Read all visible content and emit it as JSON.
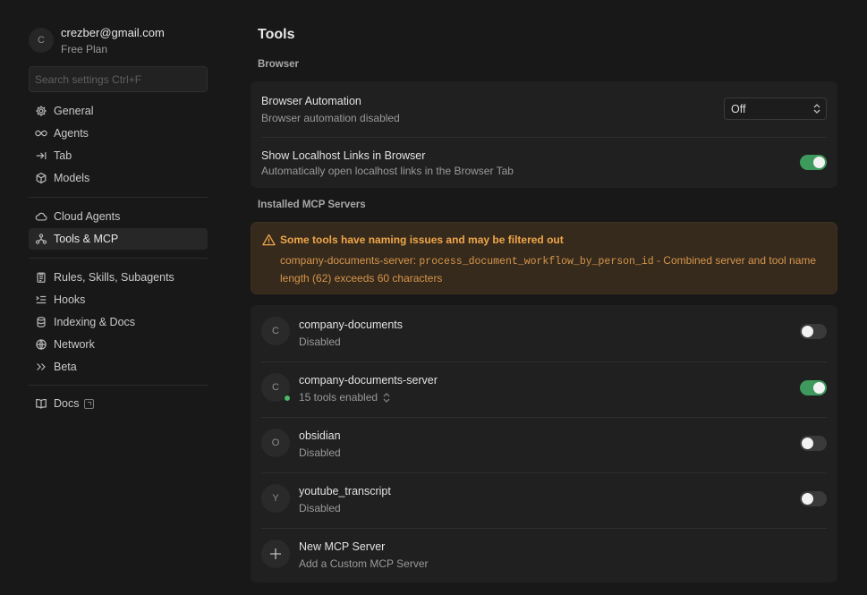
{
  "account": {
    "avatar_letter": "C",
    "email": "crezber@gmail.com",
    "plan": "Free Plan"
  },
  "search": {
    "placeholder": "Search settings Ctrl+F"
  },
  "sidebar": {
    "group1": [
      {
        "label": "General",
        "icon": "gear-icon"
      },
      {
        "label": "Agents",
        "icon": "infinity-icon"
      },
      {
        "label": "Tab",
        "icon": "tab-arrow-icon"
      },
      {
        "label": "Models",
        "icon": "cube-icon"
      }
    ],
    "group2": [
      {
        "label": "Cloud Agents",
        "icon": "cloud-icon"
      },
      {
        "label": "Tools & MCP",
        "icon": "network-nodes-icon",
        "active": true
      }
    ],
    "group3": [
      {
        "label": "Rules, Skills, Subagents",
        "icon": "clipboard-icon"
      },
      {
        "label": "Hooks",
        "icon": "hooks-list-icon"
      },
      {
        "label": "Indexing & Docs",
        "icon": "database-icon"
      },
      {
        "label": "Network",
        "icon": "globe-icon"
      },
      {
        "label": "Beta",
        "icon": "double-chevron-icon"
      }
    ],
    "group4": [
      {
        "label": "Docs",
        "icon": "book-icon"
      }
    ]
  },
  "main": {
    "title": "Tools",
    "browser_section": "Browser",
    "browser_automation": {
      "title": "Browser Automation",
      "subtitle": "Browser automation disabled",
      "select_value": "Off"
    },
    "localhost_links": {
      "title": "Show Localhost Links in Browser",
      "subtitle": "Automatically open localhost links in the Browser Tab",
      "enabled": true
    },
    "mcp_section": "Installed MCP Servers",
    "warning": {
      "title": "Some tools have naming issues and may be filtered out",
      "server": "company-documents-server: ",
      "tool": "process_document_workflow_by_person_id",
      "message_line1": " - Combined server and tool name",
      "message_line2": "length (62) exceeds 60 characters"
    },
    "servers": [
      {
        "letter": "C",
        "name": "company-documents",
        "status": "Disabled",
        "enabled": false
      },
      {
        "letter": "C",
        "name": "company-documents-server",
        "status": "15 tools enabled",
        "enabled": true,
        "online": true
      },
      {
        "letter": "O",
        "name": "obsidian",
        "status": "Disabled",
        "enabled": false
      },
      {
        "letter": "Y",
        "name": "youtube_transcript",
        "status": "Disabled",
        "enabled": false
      }
    ],
    "new_server": {
      "title": "New MCP Server",
      "subtitle": "Add a Custom MCP Server"
    }
  },
  "colors": {
    "background": "#181818",
    "card": "#202020",
    "toggle_on": "#3d9a5c",
    "warning_bg": "#362a1c",
    "warning_text": "#f0a64a"
  }
}
